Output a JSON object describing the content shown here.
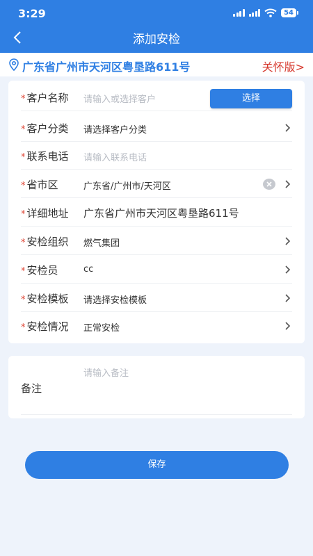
{
  "status_bar": {
    "time": "3:29",
    "battery": "54"
  },
  "nav": {
    "title": "添加安检"
  },
  "address_bar": {
    "address": "广东省广州市天河区粤垦路611号",
    "care_link": "关怀版>"
  },
  "form": {
    "required_mark": "*",
    "rows": [
      {
        "label": "客户名称",
        "value": "请输入或选择客户",
        "placeholder": true,
        "button": "选择"
      },
      {
        "label": "客户分类",
        "value": "请选择客户分类"
      },
      {
        "label": "联系电话",
        "value": "请输入联系电话",
        "placeholder": true
      },
      {
        "label": "省市区",
        "value": "广东省/广州市/天河区"
      },
      {
        "label": "详细地址",
        "value": "广东省广州市天河区粤垦路611号"
      },
      {
        "label": "安检组织",
        "value": "燃气集团"
      },
      {
        "label": "安检员",
        "value": "cc"
      },
      {
        "label": "安检模板",
        "value": "请选择安检模板"
      },
      {
        "label": "安检情况",
        "value": "正常安检"
      }
    ]
  },
  "remark": {
    "label": "备注",
    "placeholder": "请输入备注"
  },
  "save": {
    "label": "保存"
  },
  "colors": {
    "primary": "#2f7fe3",
    "required": "#e04a3a",
    "care": "#d63a2f"
  }
}
